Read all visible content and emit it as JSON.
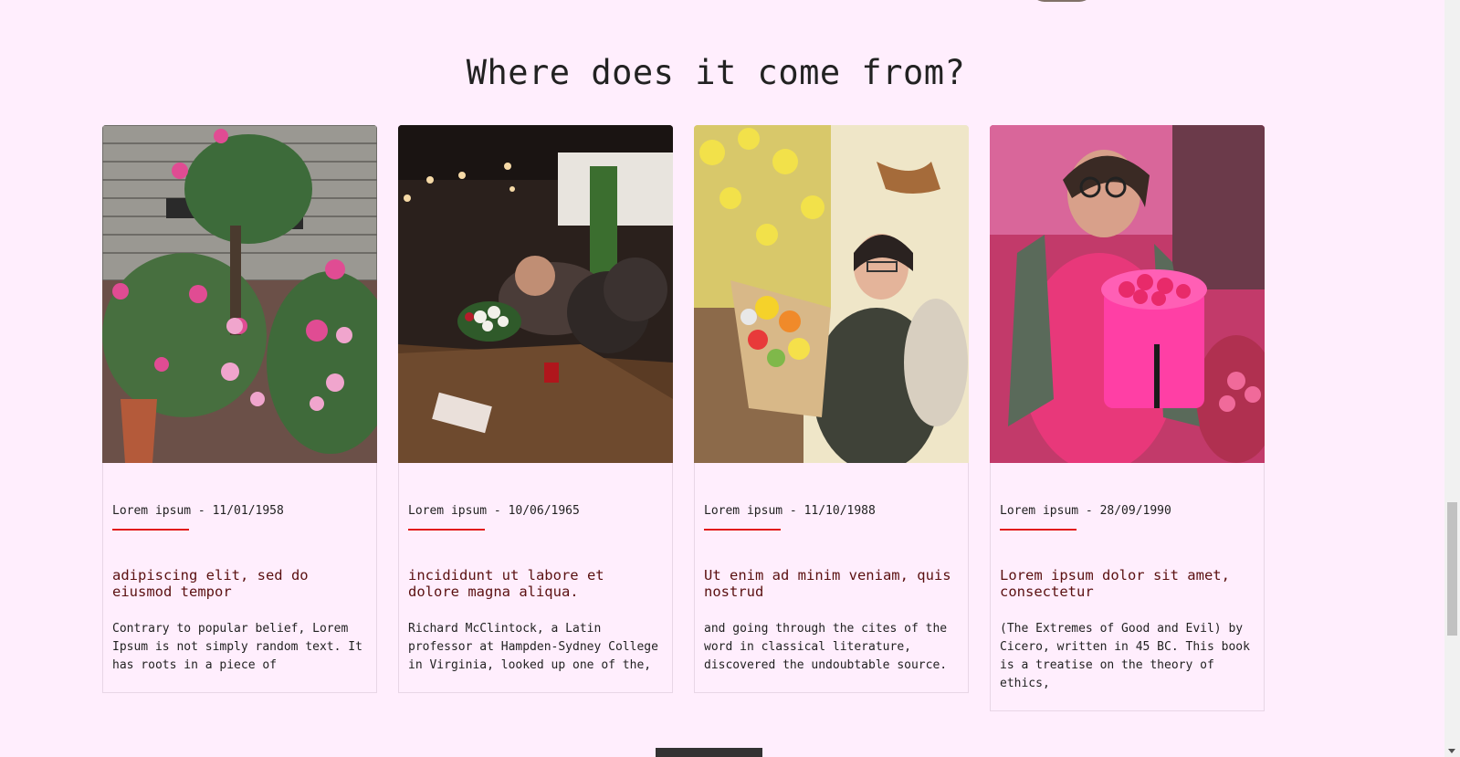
{
  "section": {
    "title": "Where does it come from?"
  },
  "cards": [
    {
      "meta": "Lorem ipsum - 11/01/1958",
      "title": "adipiscing elit, sed do eiusmod tempor",
      "text": "Contrary to popular belief, Lorem Ipsum is not simply random text. It has roots in a piece of",
      "image": "peony-garden-photo"
    },
    {
      "meta": "Lorem ipsum - 10/06/1965",
      "title": "incididunt ut labore et dolore magna aliqua.",
      "text": "Richard McClintock, a Latin professor at Hampden-Sydney College in Virginia, looked up one of the,",
      "image": "restaurant-table-photo"
    },
    {
      "meta": "Lorem ipsum - 11/10/1988",
      "title": "Ut enim ad minim veniam, quis nostrud",
      "text": "and going through the cites of the word in classical literature, discovered the undoubtable source.",
      "image": "florist-bouquet-photo"
    },
    {
      "meta": "Lorem ipsum - 28/09/1990",
      "title": "Lorem ipsum dolor sit amet, consectetur",
      "text": "(The Extremes of Good and Evil) by Cicero, written in 45 BC. This book is a treatise on the theory of ethics,",
      "image": "pink-flower-basket-photo"
    }
  ],
  "colors": {
    "background": "#ffeefd",
    "accent": "#e21b1b",
    "title": "#5a1010"
  }
}
